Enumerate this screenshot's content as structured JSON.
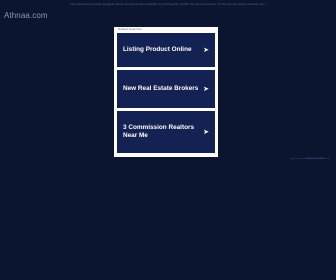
{
  "site": {
    "domain": "Athnaa.com"
  },
  "disclaimer": "The Sponsored Listings displayed above are served automatically by a third party. Neither the service provider nor the domain owner maintain any relationship with the advertisers.",
  "panel": {
    "header": "Related Searches",
    "links": [
      {
        "label": "Listing Product Online",
        "icon": "arrow-right-icon"
      },
      {
        "label": "New Real Estate Brokers",
        "icon": "arrow-right-icon"
      },
      {
        "label": "3 Commission Realtors Near Me",
        "icon": "arrow-right-icon"
      }
    ]
  },
  "footer": {
    "privacy_label": "Privacy Policy"
  },
  "colors": {
    "background": "#0b1530",
    "panel": "#ffffff",
    "link_box": "#142153",
    "link_text": "#ffffff"
  }
}
